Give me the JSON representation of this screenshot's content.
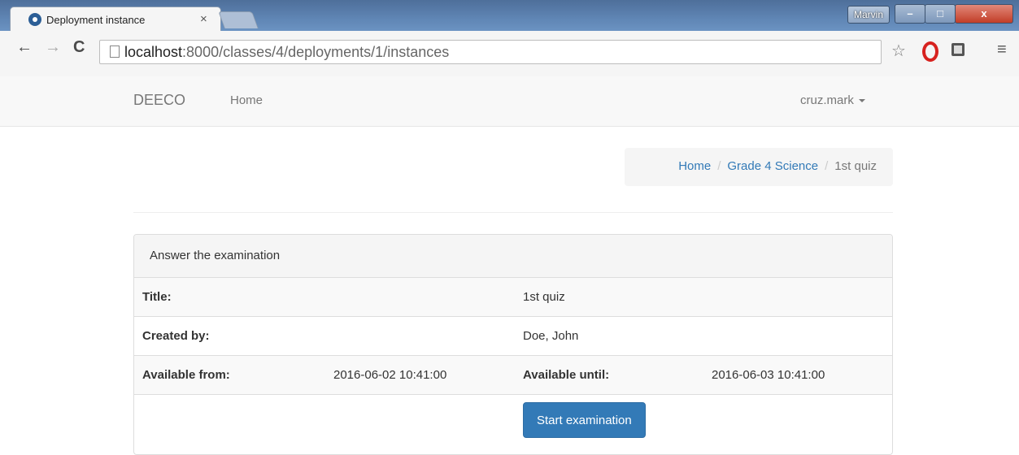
{
  "browser": {
    "tab_title": "Deployment instance",
    "tab_close": "×",
    "profile_name": "Marvin",
    "url_host": "localhost",
    "url_path": ":8000/classes/4/deployments/1/instances"
  },
  "navbar": {
    "brand": "DEECO",
    "home": "Home",
    "user": "cruz.mark"
  },
  "breadcrumb": {
    "items": [
      "Home",
      "Grade 4 Science",
      "1st quiz"
    ],
    "separator": "/"
  },
  "panel": {
    "heading": "Answer the examination",
    "title_label": "Title:",
    "title_value": "1st quiz",
    "created_by_label": "Created by:",
    "created_by_value": "Doe, John",
    "available_from_label": "Available from:",
    "available_from_value": "2016-06-02 10:41:00",
    "available_until_label": "Available until:",
    "available_until_value": "2016-06-03 10:41:00",
    "start_button": "Start examination"
  },
  "colors": {
    "primary": "#337ab7",
    "link": "#337ab7",
    "navbar_bg": "#f8f8f8"
  }
}
